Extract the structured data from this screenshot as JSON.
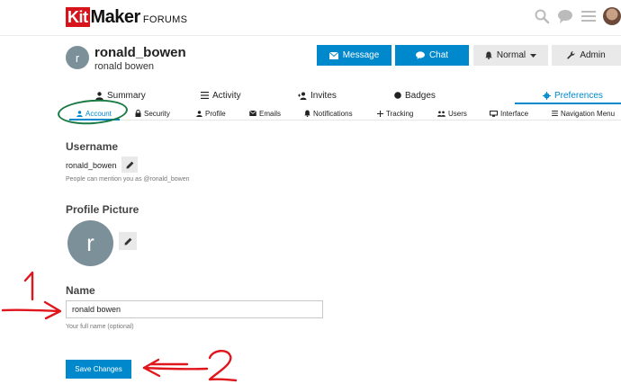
{
  "header": {
    "logo_kit": "Kit",
    "logo_maker": "Maker",
    "logo_forums": "FORUMS",
    "icons": [
      "search-icon",
      "chat-icon",
      "hamburger-icon",
      "avatar"
    ]
  },
  "user": {
    "avatar_letter": "r",
    "username": "ronald_bowen",
    "full_name": "ronald bowen"
  },
  "actions": {
    "message": "Message",
    "chat": "Chat",
    "normal": "Normal",
    "admin": "Admin"
  },
  "nav": {
    "summary": "Summary",
    "activity": "Activity",
    "invites": "Invites",
    "badges": "Badges",
    "preferences": "Preferences"
  },
  "subnav": {
    "account": "Account",
    "security": "Security",
    "profile": "Profile",
    "emails": "Emails",
    "notifications": "Notifications",
    "tracking": "Tracking",
    "users": "Users",
    "interface": "Interface",
    "navigation_menu": "Navigation Menu"
  },
  "form": {
    "username_title": "Username",
    "username_value": "ronald_bowen",
    "username_hint": "People can mention you as @ronald_bowen",
    "picture_title": "Profile Picture",
    "picture_letter": "r",
    "name_title": "Name",
    "name_value": "ronald bowen",
    "name_hint": "Your full name (optional)",
    "save": "Save Changes"
  },
  "colors": {
    "primary": "#0088cc",
    "logo_red": "#d7131b",
    "avatar_gray": "#7c909a",
    "annotation_red": "#e0161d",
    "annotation_green": "#1a7a44"
  }
}
